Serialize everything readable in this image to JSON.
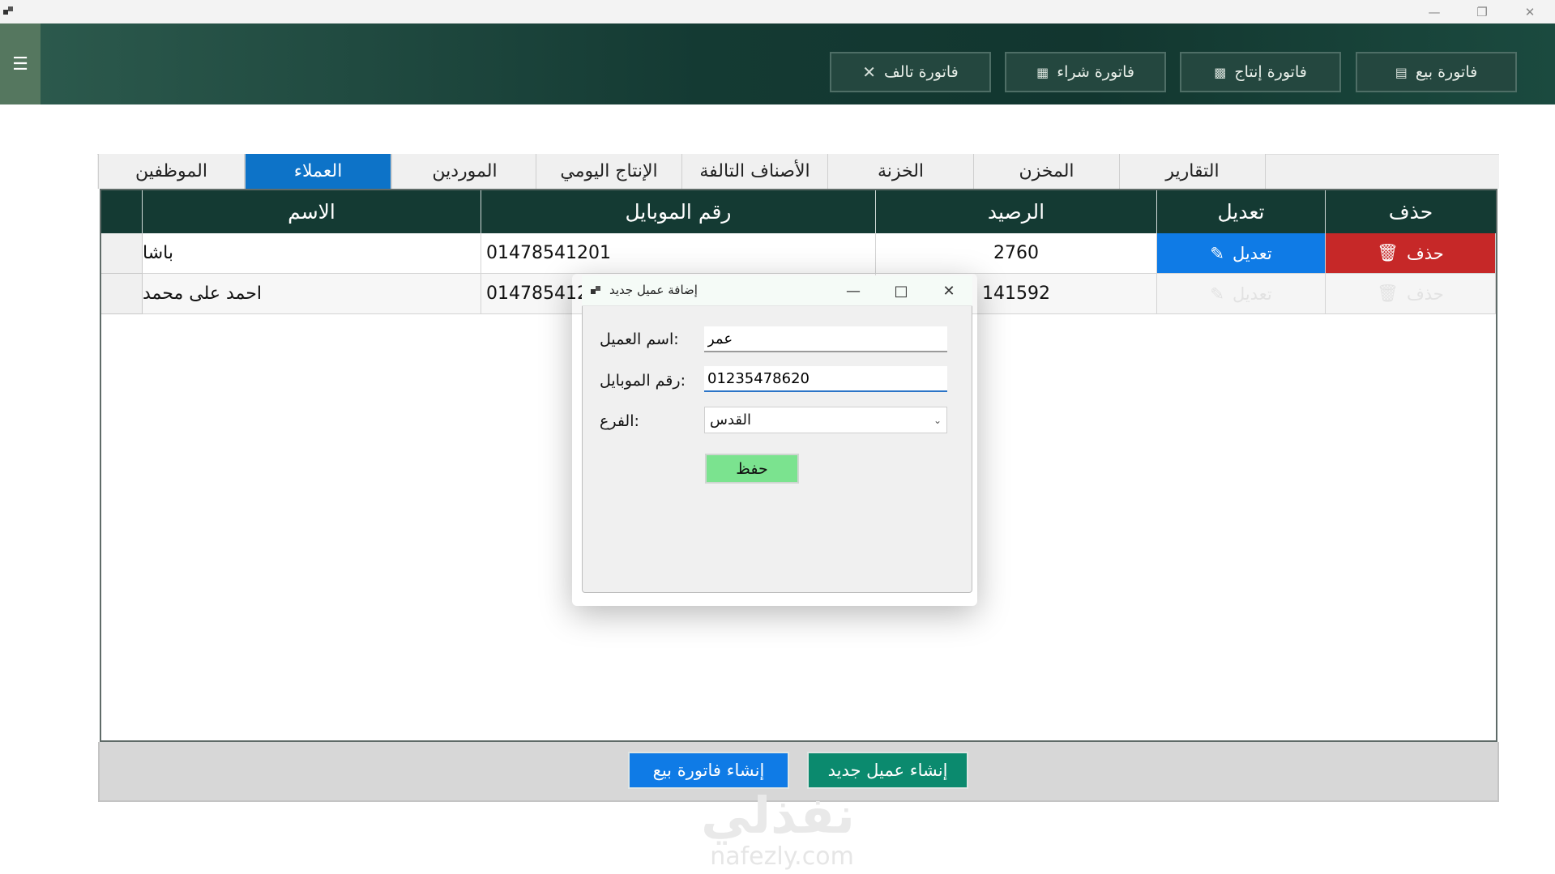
{
  "window": {
    "minimize_icon": "minimize-icon",
    "restore_icon": "restore-icon",
    "close_icon": "close-icon"
  },
  "header": {
    "menu_icon": "hamburger-menu-icon",
    "buttons": [
      {
        "label": "فاتورة بيع",
        "icon": "receipt-icon"
      },
      {
        "label": "فاتورة إنتاج",
        "icon": "factory-icon"
      },
      {
        "label": "فاتورة شراء",
        "icon": "document-icon"
      },
      {
        "label": "فاتورة تالف",
        "icon": "x-icon"
      }
    ]
  },
  "tabs": [
    {
      "label": "الموظفين"
    },
    {
      "label": "العملاء",
      "active": true
    },
    {
      "label": "الموردين"
    },
    {
      "label": "الإنتاج اليومي"
    },
    {
      "label": "الأصناف التالفة"
    },
    {
      "label": "الخزنة"
    },
    {
      "label": "المخزن"
    },
    {
      "label": "التقارير"
    }
  ],
  "grid": {
    "columns": [
      "الاسم",
      "رقم الموبايل",
      "الرصيد",
      "تعديل",
      "حذف"
    ],
    "rows": [
      {
        "name": "باشا",
        "mobile": "01478541201",
        "balance": "2760",
        "edit": "تعديل",
        "delete": "حذف"
      },
      {
        "name": "احمد على محمد",
        "mobile": "014785412",
        "balance": "141592",
        "edit": "تعديل",
        "delete": "حذف"
      }
    ]
  },
  "bottom": {
    "new_invoice": "إنشاء فاتورة بيع",
    "new_customer": "إنشاء عميل جديد"
  },
  "dialog": {
    "title": "إضافة عميل جديد",
    "name_label": ":اسم العميل",
    "name_value": "عمر",
    "mobile_label": ":رقم الموبايل",
    "mobile_value": "01235478620",
    "branch_label": ":الفرع",
    "branch_value": "القدس",
    "save_label": "حفظ"
  },
  "watermark": {
    "arabic": "نفذلي",
    "latin": "nafezly.com"
  },
  "colors": {
    "header": "#143a33",
    "active_tab": "#0d73c8",
    "edit": "#0f7be6",
    "delete": "#c62828",
    "save": "#7be38f",
    "new_customer": "#0b8a6e"
  }
}
